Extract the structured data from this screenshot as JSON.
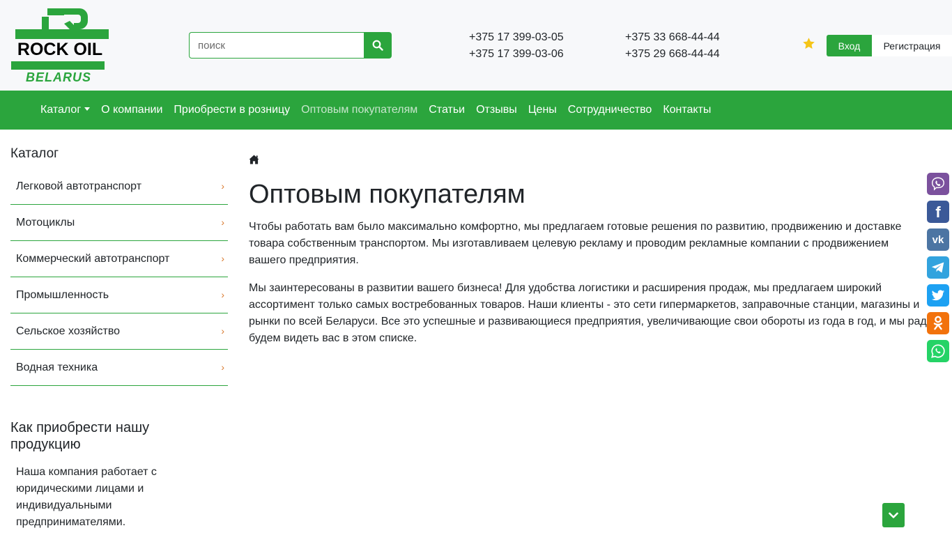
{
  "header": {
    "logo": {
      "brand": "ROCK OIL",
      "region": "BELARUS"
    },
    "search": {
      "placeholder": "поиск"
    },
    "phones": {
      "col1": [
        "+375 17 399-03-05",
        "+375 17 399-03-06"
      ],
      "col2": [
        "+375 33 668-44-44",
        "+375 29 668-44-44"
      ]
    },
    "auth": {
      "login_label": "Вход",
      "register_label": "Регистрация"
    }
  },
  "nav": {
    "items": [
      {
        "label": "Каталог"
      },
      {
        "label": "О компании"
      },
      {
        "label": "Приобрести в розницу"
      },
      {
        "label": "Оптовым покупателям"
      },
      {
        "label": "Статьи"
      },
      {
        "label": "Отзывы"
      },
      {
        "label": "Цены"
      },
      {
        "label": "Сотрудничество"
      },
      {
        "label": "Контакты"
      }
    ],
    "active_index": 3
  },
  "sidebar": {
    "title": "Каталог",
    "items": [
      {
        "label": "Легковой автотранспорт"
      },
      {
        "label": "Мотоциклы"
      },
      {
        "label": "Коммерческий автотранспорт"
      },
      {
        "label": "Промышленность"
      },
      {
        "label": "Сельское хозяйство"
      },
      {
        "label": "Водная техника"
      }
    ],
    "chevron": "›",
    "howto_title": "Как приобрести нашу продукцию",
    "howto_text": "Наша компания работает с юридическими лицами и индивидуальными предпринимателями."
  },
  "main": {
    "title": "Оптовым покупателям",
    "p1_lines": [
      "Чтобы работать вам было максимально комфортно, мы предлагаем готовые решения по развитию, продвижению и доставке",
      "товара собственным транспортом. Мы изготавливаем целевую рекламу и проводим рекламные компании с продвижением",
      "вашего предприятия."
    ],
    "p2_lines": [
      "Мы заинтересованы в развитии вашего бизнеса! Для удобства логистики и расширения продаж, мы предлагаем широкий",
      "ассортимент только самых востребованных товаров. Наши клиенты - это сети гипермаркетов, заправочные станции, магазины и",
      "рынки по всей Беларуси. Все это успешные и развивающиеся предприятия, увеличивающие свои обороты из года в год, и мы рад",
      "будем видеть вас в этом списке."
    ]
  },
  "colors": {
    "brand_green": "#2ba53d",
    "chevron_orange": "#d9782d",
    "viber": "#7b519d",
    "facebook": "#3b5998",
    "vk": "#4c75a3",
    "telegram": "#32a3de",
    "twitter": "#1da1f2",
    "odnoklassniki": "#f2720c",
    "whatsapp": "#25d366"
  },
  "social": {
    "icons": [
      "viber-icon",
      "facebook-icon",
      "vk-icon",
      "telegram-icon",
      "twitter-icon",
      "odnoklassniki-icon",
      "whatsapp-icon"
    ],
    "facebook_glyph": "f",
    "vk_glyph": "vk"
  }
}
